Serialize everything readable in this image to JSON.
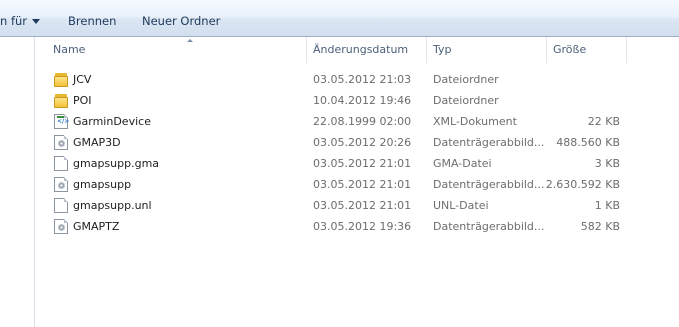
{
  "toolbar": {
    "share_label": "n für",
    "burn_label": "Brennen",
    "new_folder_label": "Neuer Ordner"
  },
  "columns": {
    "name": "Name",
    "date": "Änderungsdatum",
    "type": "Typ",
    "size": "Größe"
  },
  "files": [
    {
      "name": "JCV",
      "date": "03.05.2012 21:03",
      "type": "Dateiordner",
      "size": "",
      "icon": "folder-icon"
    },
    {
      "name": "POI",
      "date": "10.04.2012 19:46",
      "type": "Dateiordner",
      "size": "",
      "icon": "folder-icon"
    },
    {
      "name": "GarminDevice",
      "date": "22.08.1999 02:00",
      "type": "XML-Dokument",
      "size": "22 KB",
      "icon": "xml-file-icon"
    },
    {
      "name": "GMAP3D",
      "date": "03.05.2012 20:26",
      "type": "Datenträgerabbild...",
      "size": "488.560 KB",
      "icon": "disk-image-icon"
    },
    {
      "name": "gmapsupp.gma",
      "date": "03.05.2012 21:01",
      "type": "GMA-Datei",
      "size": "3 KB",
      "icon": "file-icon"
    },
    {
      "name": "gmapsupp",
      "date": "03.05.2012 21:01",
      "type": "Datenträgerabbild...",
      "size": "2.630.592 KB",
      "icon": "disk-image-icon"
    },
    {
      "name": "gmapsupp.unl",
      "date": "03.05.2012 21:01",
      "type": "UNL-Datei",
      "size": "1 KB",
      "icon": "file-icon"
    },
    {
      "name": "GMAPTZ",
      "date": "03.05.2012 19:36",
      "type": "Datenträgerabbild...",
      "size": "582 KB",
      "icon": "disk-image-icon"
    }
  ]
}
